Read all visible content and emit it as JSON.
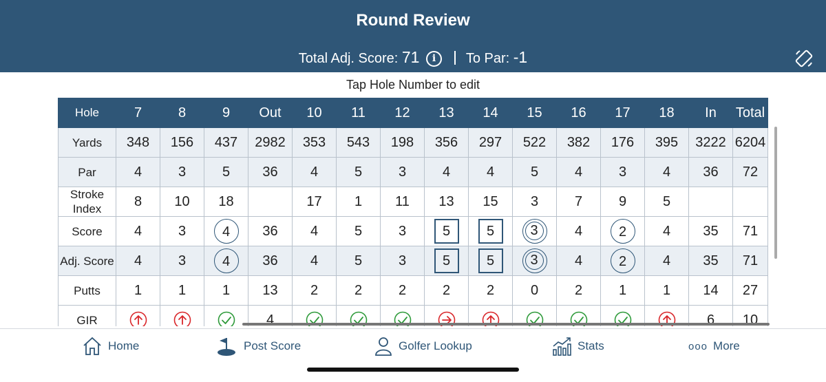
{
  "header": {
    "title": "Round Review",
    "total_label": "Total Adj. Score:",
    "total_value": "71",
    "info_icon": "i",
    "par_label": "To Par:",
    "par_value": "-1",
    "rotate_icon": "rotate-screen-icon"
  },
  "hint": "Tap Hole Number to edit",
  "scorecard": {
    "columns": [
      "Hole",
      "7",
      "8",
      "9",
      "Out",
      "10",
      "11",
      "12",
      "13",
      "14",
      "15",
      "16",
      "17",
      "18",
      "In",
      "Total"
    ],
    "rows": {
      "yards": {
        "label": "Yards",
        "values": [
          "348",
          "156",
          "437",
          "2982",
          "353",
          "543",
          "198",
          "356",
          "297",
          "522",
          "382",
          "176",
          "395",
          "3222",
          "6204"
        ]
      },
      "par": {
        "label": "Par",
        "values": [
          "4",
          "3",
          "5",
          "36",
          "4",
          "5",
          "3",
          "4",
          "4",
          "5",
          "4",
          "3",
          "4",
          "36",
          "72"
        ]
      },
      "stroke_index": {
        "label": "Stroke Index",
        "values": [
          "8",
          "10",
          "18",
          "",
          "17",
          "1",
          "11",
          "13",
          "15",
          "3",
          "7",
          "9",
          "5",
          "",
          ""
        ]
      },
      "score": {
        "label": "Score",
        "values": [
          "4",
          "3",
          "4",
          "36",
          "4",
          "5",
          "3",
          "5",
          "5",
          "3",
          "4",
          "2",
          "4",
          "35",
          "71"
        ]
      },
      "adj_score": {
        "label": "Adj. Score",
        "values": [
          "4",
          "3",
          "4",
          "36",
          "4",
          "5",
          "3",
          "5",
          "5",
          "3",
          "4",
          "2",
          "4",
          "35",
          "71"
        ]
      },
      "putts": {
        "label": "Putts",
        "values": [
          "1",
          "1",
          "1",
          "13",
          "2",
          "2",
          "2",
          "2",
          "2",
          "0",
          "2",
          "1",
          "1",
          "14",
          "27"
        ]
      },
      "gir": {
        "label": "GIR",
        "values": [
          "miss-up",
          "miss-up",
          "hit",
          "4",
          "hit",
          "hit",
          "hit",
          "miss-right",
          "miss-up",
          "hit",
          "hit",
          "hit",
          "miss-up",
          "6",
          "10"
        ]
      }
    },
    "colors": {
      "hit": "#2e9a3a",
      "miss": "#d9262a",
      "accent": "#2f5677"
    }
  },
  "tabbar": {
    "home": "Home",
    "post_score": "Post Score",
    "golfer_lookup": "Golfer Lookup",
    "stats": "Stats",
    "more": "More",
    "more_icon": "ooo"
  }
}
